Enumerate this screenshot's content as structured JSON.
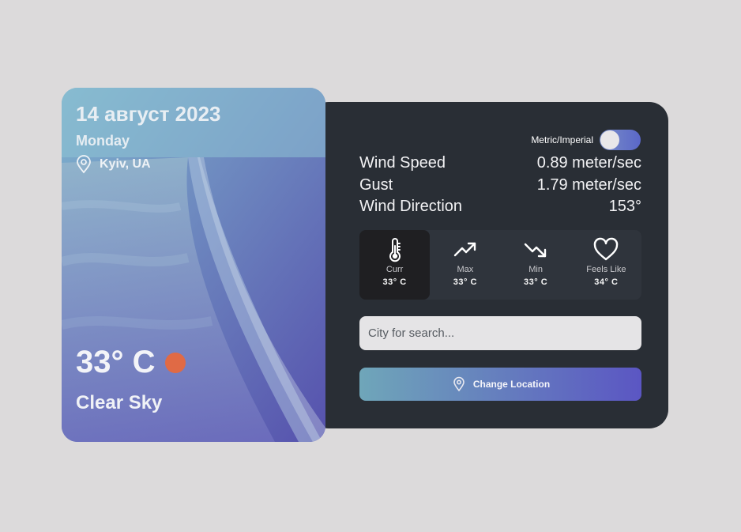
{
  "card": {
    "date": "14 август 2023",
    "day": "Monday",
    "location": "Kyiv, UA",
    "temperature": "33° C",
    "condition": "Clear Sky",
    "sun_color": "#e06a45"
  },
  "panel": {
    "toggle_label": "Metric/Imperial",
    "wind": [
      {
        "label": "Wind Speed",
        "value": "0.89 meter/sec"
      },
      {
        "label": "Gust",
        "value": "1.79 meter/sec"
      },
      {
        "label": "Wind Direction",
        "value": "153°"
      }
    ],
    "stats": [
      {
        "icon": "thermometer-icon",
        "label": "Curr",
        "value": "33° C"
      },
      {
        "icon": "trending-up-icon",
        "label": "Max",
        "value": "33° C"
      },
      {
        "icon": "trending-down-icon",
        "label": "Min",
        "value": "33° C"
      },
      {
        "icon": "heart-icon",
        "label": "Feels Like",
        "value": "34° C"
      }
    ],
    "search_placeholder": "City for search...",
    "change_button": "Change Location"
  }
}
